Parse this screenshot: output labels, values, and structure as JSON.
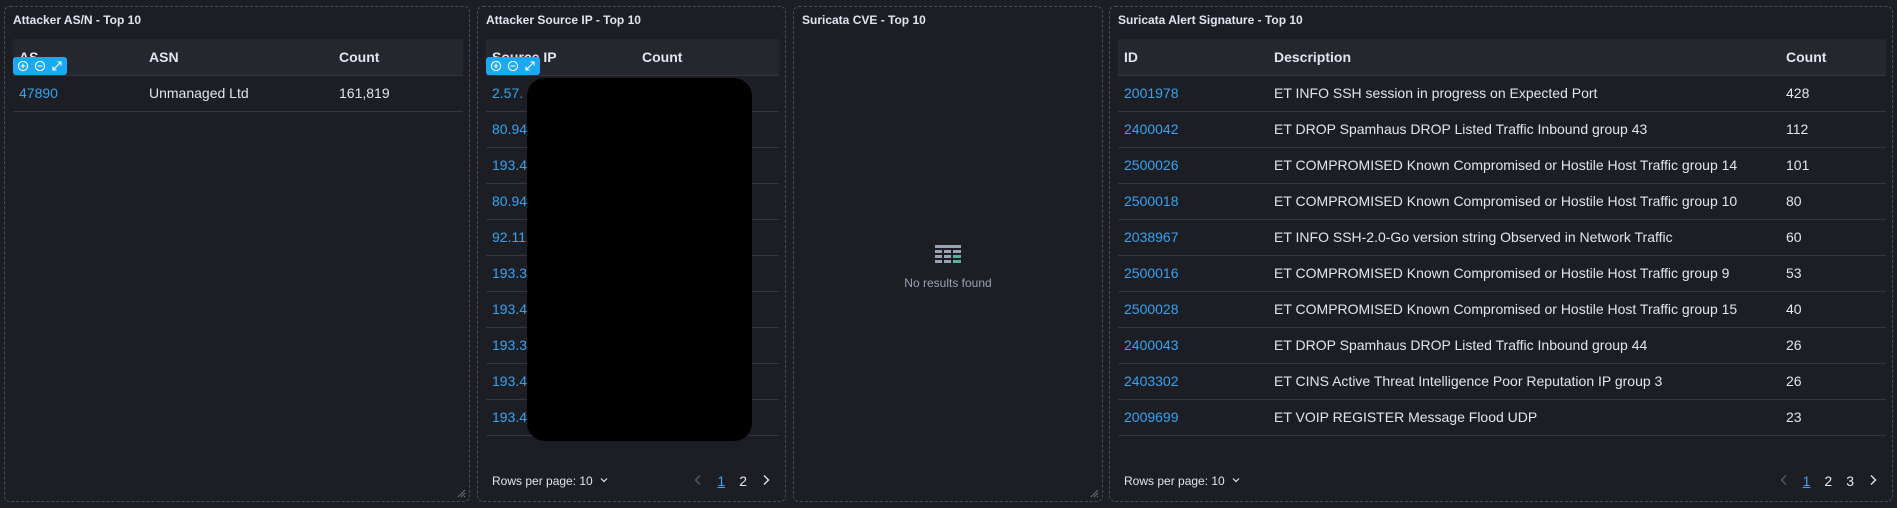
{
  "panels": {
    "asn": {
      "title": "Attacker AS/N - Top 10",
      "columns": [
        "AS",
        "ASN",
        "Count"
      ],
      "rows": [
        {
          "as": "47890",
          "asn": "Unmanaged Ltd",
          "count": "161,819"
        }
      ]
    },
    "source_ip": {
      "title": "Attacker Source IP - Top 10",
      "columns": [
        "Source IP",
        "Count"
      ],
      "rows": [
        {
          "ip": "2.57."
        },
        {
          "ip": "80.94"
        },
        {
          "ip": "193.4"
        },
        {
          "ip": "80.94"
        },
        {
          "ip": "92.11"
        },
        {
          "ip": "193.3"
        },
        {
          "ip": "193.4"
        },
        {
          "ip": "193.3"
        },
        {
          "ip": "193.4"
        },
        {
          "ip": "193.4"
        }
      ],
      "rows_per_page": "Rows per page: 10",
      "pages": [
        "1",
        "2"
      ]
    },
    "cve": {
      "title": "Suricata CVE - Top 10",
      "empty_text": "No results found"
    },
    "signature": {
      "title": "Suricata Alert Signature - Top 10",
      "columns": [
        "ID",
        "Description",
        "Count"
      ],
      "rows": [
        {
          "id": "2001978",
          "description": "ET INFO SSH session in progress on Expected Port",
          "count": "428"
        },
        {
          "id": "2400042",
          "description": "ET DROP Spamhaus DROP Listed Traffic Inbound group 43",
          "count": "112"
        },
        {
          "id": "2500026",
          "description": "ET COMPROMISED Known Compromised or Hostile Host Traffic group 14",
          "count": "101"
        },
        {
          "id": "2500018",
          "description": "ET COMPROMISED Known Compromised or Hostile Host Traffic group 10",
          "count": "80"
        },
        {
          "id": "2038967",
          "description": "ET INFO SSH-2.0-Go version string Observed in Network Traffic",
          "count": "60"
        },
        {
          "id": "2500016",
          "description": "ET COMPROMISED Known Compromised or Hostile Host Traffic group 9",
          "count": "53"
        },
        {
          "id": "2500028",
          "description": "ET COMPROMISED Known Compromised or Hostile Host Traffic group 15",
          "count": "40"
        },
        {
          "id": "2400043",
          "description": "ET DROP Spamhaus DROP Listed Traffic Inbound group 44",
          "count": "26"
        },
        {
          "id": "2403302",
          "description": "ET CINS Active Threat Intelligence Poor Reputation IP group 3",
          "count": "26"
        },
        {
          "id": "2009699",
          "description": "ET VOIP REGISTER Message Flood UDP",
          "count": "23"
        }
      ],
      "rows_per_page": "Rows per page: 10",
      "pages": [
        "1",
        "2",
        "3"
      ]
    }
  },
  "colors": {
    "link": "#36a2ef",
    "accent": "#1ba9f5",
    "background": "#1d1e24"
  },
  "icons": [
    "zoom-in-icon",
    "zoom-out-icon",
    "expand-icon",
    "chevron-down-icon",
    "chevron-left-icon",
    "chevron-right-icon",
    "table-icon",
    "resize-icon"
  ]
}
